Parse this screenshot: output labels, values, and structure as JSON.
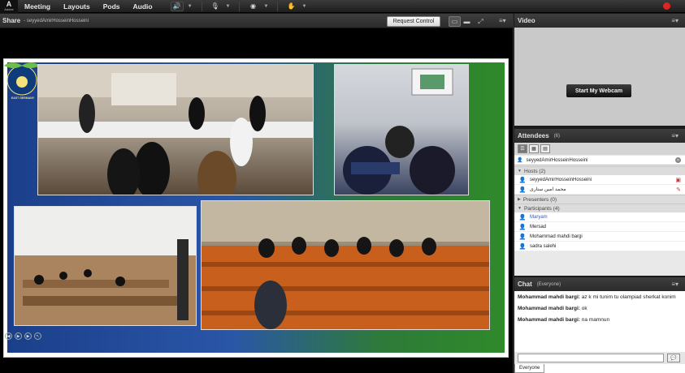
{
  "menubar": {
    "logo": "Adobe",
    "items": [
      "Meeting",
      "Layouts",
      "Pods",
      "Audio"
    ]
  },
  "share": {
    "title": "Share",
    "presenter": "- seyyedAmirHosseinHosseini",
    "request_control": "Request Control"
  },
  "slide": {
    "logo_text": "EAST GERMANY"
  },
  "video": {
    "title": "Video",
    "start_webcam": "Start My Webcam"
  },
  "attendees": {
    "title": "Attendees",
    "count": "(6)",
    "search_value": "seyyedAmirHosseinHosseini",
    "hosts_label": "Hosts (2)",
    "hosts": [
      {
        "name": "seyyedAmirHosseinHosseini"
      },
      {
        "name": "محمد امین ستاری"
      }
    ],
    "presenters_label": "Presenters (0)",
    "participants_label": "Participants (4)",
    "participants": [
      {
        "name": "Maryam"
      },
      {
        "name": "Mersad"
      },
      {
        "name": "Mohammad mahdi bargi"
      },
      {
        "name": "sadra salehi"
      }
    ]
  },
  "chat": {
    "title": "Chat",
    "scope": "(Everyone)",
    "messages": [
      {
        "sender": "Mohammad mahdi bargi:",
        "text": " az k mi tunim tu olampiad sherkat konim"
      },
      {
        "sender": "Mohammad mahdi bargi:",
        "text": " ok"
      },
      {
        "sender": "Mohammad mahdi bargi:",
        "text": " na mamnun"
      }
    ],
    "tab": "Everyone"
  }
}
